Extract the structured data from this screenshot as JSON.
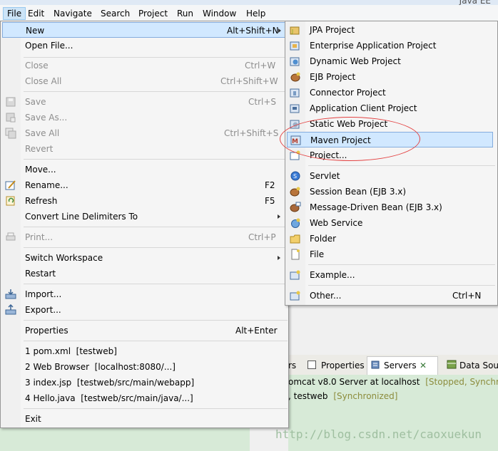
{
  "window": {
    "title": "Java EE"
  },
  "menubar": [
    "File",
    "Edit",
    "Navigate",
    "Search",
    "Project",
    "Run",
    "Window",
    "Help"
  ],
  "file_menu": [
    {
      "label": "New",
      "accel": "Alt+Shift+N",
      "submenu": true,
      "highlighted": true
    },
    {
      "label": "Open File..."
    },
    {
      "label": "Close",
      "accel": "Ctrl+W",
      "disabled": true
    },
    {
      "label": "Close All",
      "accel": "Ctrl+Shift+W",
      "disabled": true
    },
    {
      "label": "Save",
      "accel": "Ctrl+S",
      "disabled": true
    },
    {
      "label": "Save As...",
      "disabled": true
    },
    {
      "label": "Save All",
      "accel": "Ctrl+Shift+S",
      "disabled": true
    },
    {
      "label": "Revert",
      "disabled": true
    },
    {
      "label": "Move..."
    },
    {
      "label": "Rename...",
      "accel": "F2"
    },
    {
      "label": "Refresh",
      "accel": "F5"
    },
    {
      "label": "Convert Line Delimiters To",
      "submenu": true
    },
    {
      "label": "Print...",
      "accel": "Ctrl+P",
      "disabled": true
    },
    {
      "label": "Switch Workspace",
      "submenu": true
    },
    {
      "label": "Restart"
    },
    {
      "label": "Import..."
    },
    {
      "label": "Export..."
    },
    {
      "label": "Properties",
      "accel": "Alt+Enter"
    },
    {
      "label": "1 pom.xml  [testweb]"
    },
    {
      "label": "2 Web Browser  [localhost:8080/...]"
    },
    {
      "label": "3 index.jsp  [testweb/src/main/webapp]"
    },
    {
      "label": "4 Hello.java  [testweb/src/main/java/...]"
    },
    {
      "label": "Exit"
    }
  ],
  "new_submenu": [
    {
      "label": "JPA Project",
      "icon": "jpa-project-icon"
    },
    {
      "label": "Enterprise Application Project",
      "icon": "ear-project-icon"
    },
    {
      "label": "Dynamic Web Project",
      "icon": "web-project-icon"
    },
    {
      "label": "EJB Project",
      "icon": "ejb-project-icon"
    },
    {
      "label": "Connector Project",
      "icon": "connector-project-icon"
    },
    {
      "label": "Application Client Project",
      "icon": "app-client-icon"
    },
    {
      "label": "Static Web Project",
      "icon": "static-web-icon"
    },
    {
      "label": "Maven Project",
      "icon": "maven-project-icon",
      "highlighted": true
    },
    {
      "label": "Project...",
      "icon": "project-icon"
    },
    {
      "label": "Servlet",
      "icon": "servlet-icon"
    },
    {
      "label": "Session Bean (EJB 3.x)",
      "icon": "session-bean-icon"
    },
    {
      "label": "Message-Driven Bean (EJB 3.x)",
      "icon": "mdb-icon"
    },
    {
      "label": "Web Service",
      "icon": "web-service-icon"
    },
    {
      "label": "Folder",
      "icon": "folder-icon"
    },
    {
      "label": "File",
      "icon": "file-icon"
    },
    {
      "label": "Example...",
      "icon": "example-icon"
    },
    {
      "label": "Other...",
      "accel": "Ctrl+N",
      "icon": "other-icon"
    }
  ],
  "bottom_tabs": [
    "rs",
    "Properties",
    "Servers",
    "Data Sou"
  ],
  "servers": [
    {
      "name": "omcat v8.0 Server at localhost",
      "status": "[Stopped, Synchron"
    },
    {
      "name": ", testweb",
      "status": "[Synchronized]"
    }
  ],
  "watermark": "http://blog.csdn.net/caoxuekun",
  "colors": {
    "menu_highlight": "#d1e8ff",
    "annotation_ellipse": "#e34242",
    "status_text": "#8c8c3c"
  }
}
